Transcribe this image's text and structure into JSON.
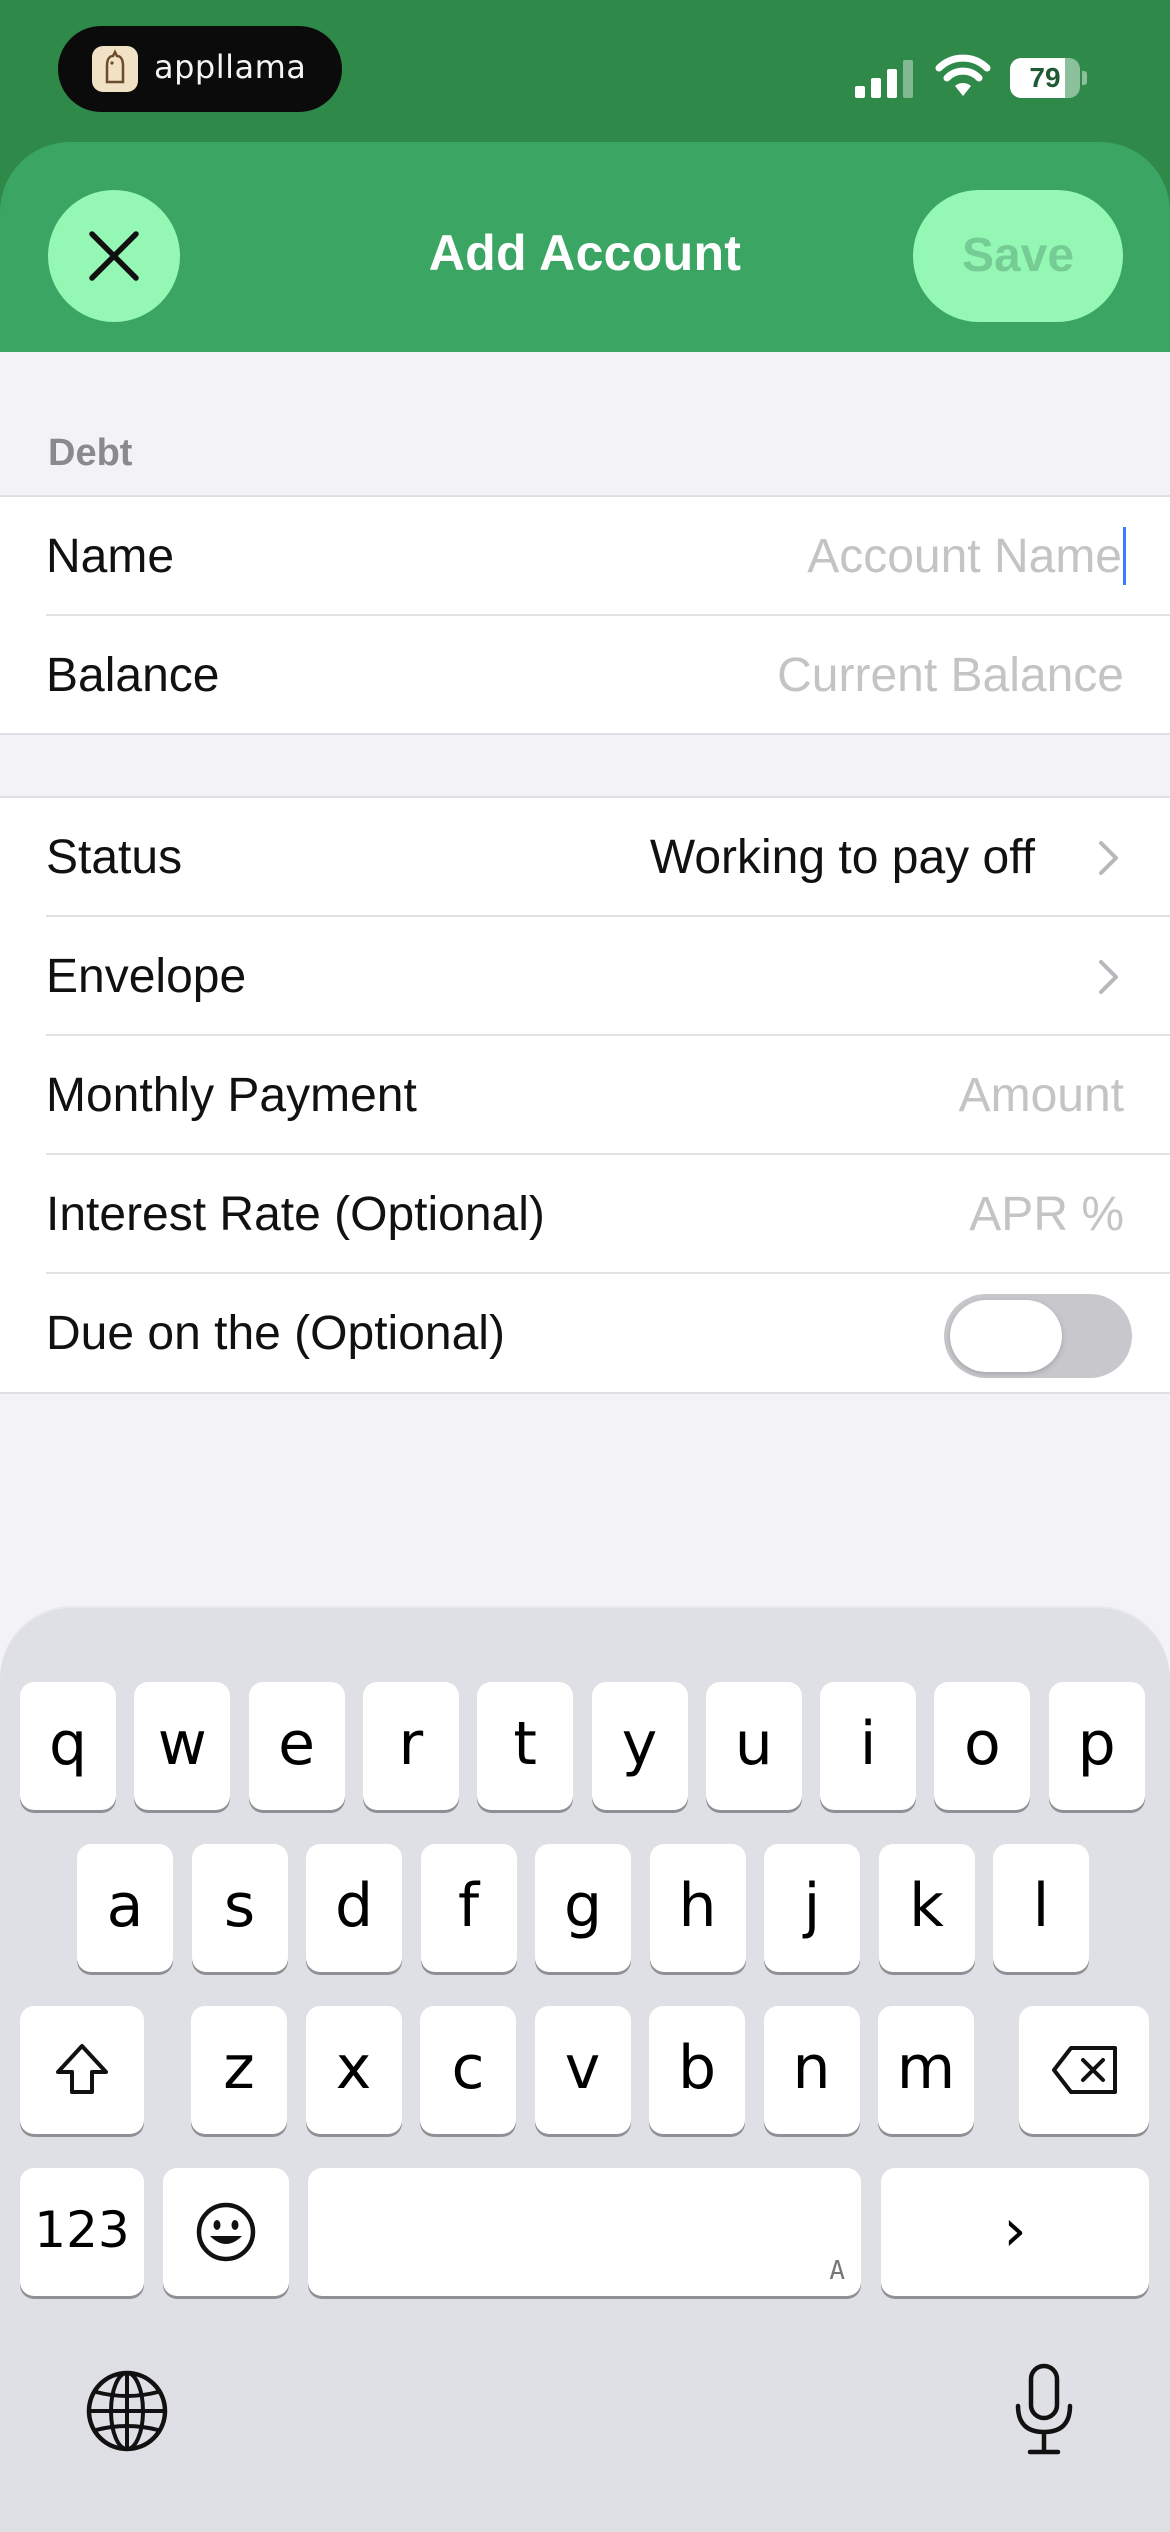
{
  "status_bar": {
    "island_app": "appllama",
    "battery": "79",
    "battery_level": 0.79
  },
  "nav": {
    "title": "Add Account",
    "save_label": "Save"
  },
  "form": {
    "section_title": "Debt",
    "name": {
      "label": "Name",
      "placeholder": "Account Name"
    },
    "balance": {
      "label": "Balance",
      "placeholder": "Current Balance"
    },
    "status": {
      "label": "Status",
      "value": "Working to pay off"
    },
    "envelope": {
      "label": "Envelope"
    },
    "monthly_payment": {
      "label": "Monthly Payment",
      "placeholder": "Amount"
    },
    "interest_rate": {
      "label": "Interest Rate (Optional)",
      "placeholder": "APR %"
    },
    "due_on": {
      "label": "Due on the (Optional)",
      "enabled": false
    }
  },
  "keyboard": {
    "row1": [
      "q",
      "w",
      "e",
      "r",
      "t",
      "y",
      "u",
      "i",
      "o",
      "p"
    ],
    "row2": [
      "a",
      "s",
      "d",
      "f",
      "g",
      "h",
      "j",
      "k",
      "l"
    ],
    "row3": [
      "z",
      "x",
      "c",
      "v",
      "b",
      "n",
      "m"
    ],
    "numbers_label": "123",
    "space_mark": "A",
    "return_label": "›"
  },
  "colors": {
    "header_green": "#2f8a4a",
    "sheet_green": "#3ba663",
    "button_mint": "#95f7b4"
  }
}
